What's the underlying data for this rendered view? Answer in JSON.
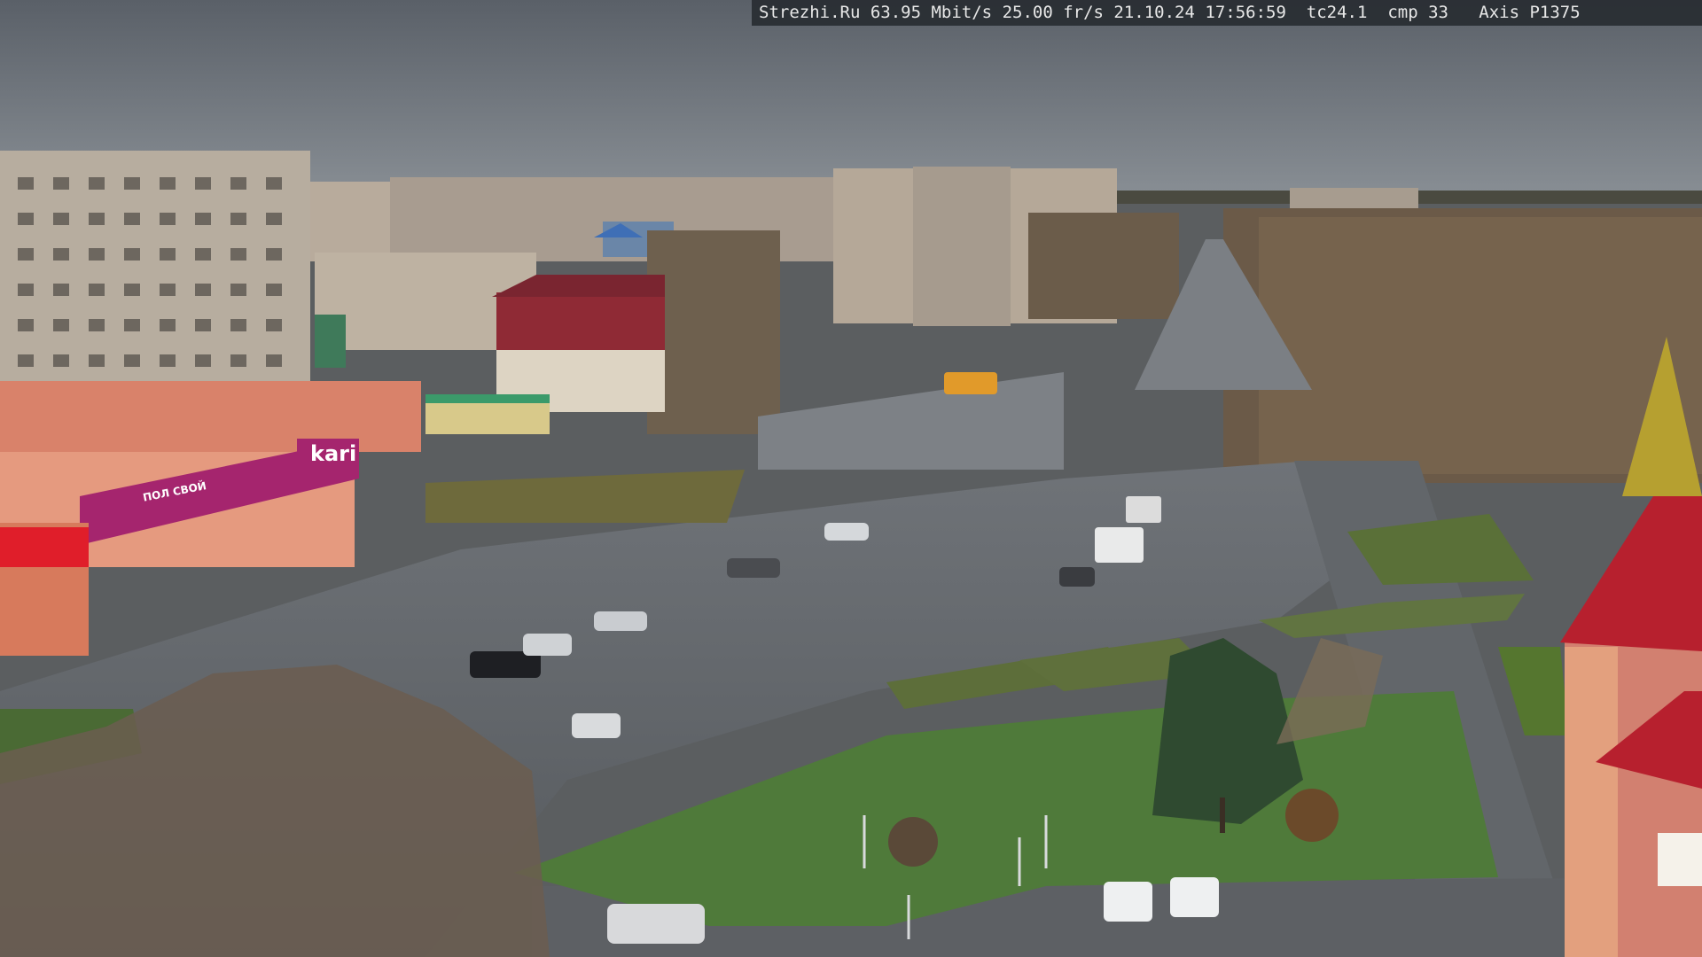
{
  "overlay": {
    "site": "Strezhi.Ru",
    "bitrate": "63.95 Mbit/s",
    "framerate": "25.00 fr/s",
    "date": "21.10.24",
    "time": "17:56:59",
    "tc": "tc24.1",
    "cmp": "cmp 33",
    "camera": "Axis P1375"
  },
  "signs": {
    "store_main": "kari",
    "store_sub": "ПОЛ СВОЙ"
  }
}
